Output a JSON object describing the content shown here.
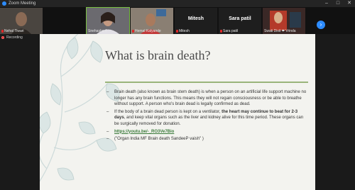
{
  "window": {
    "title": "Zoom Meeting"
  },
  "participants": [
    {
      "name": "Nehal Tiwari",
      "muted": true
    },
    {
      "name": "Snehasha J",
      "muted": false
    },
    {
      "name": "Hemal Kalyande",
      "muted": true
    },
    {
      "name": "Mitesh",
      "muted": true,
      "video": false
    },
    {
      "name": "Sara patil",
      "muted": true,
      "video": false
    },
    {
      "name": "Swati Dixit ❤ Vrinda",
      "muted": false
    }
  ],
  "recording": {
    "label": "Recording"
  },
  "slide": {
    "title": "What is brain death?",
    "b1": "Brain death (also known as brain stem death) is when a person on an artificial life support machine no longer has any brain functions. This means they will not regain consciousness or be able to breathe without support. A person who's brain dead is legally confirmed as dead.",
    "b2_pre": "If the body of a brain dead person is kept on a ventilator, ",
    "b2_bold": "the heart may continue to beat for 2-3 days",
    "b2_post": ", and keep vital organs such as the liver and kidney alive for this time period. These organs can be surgically removed for donation.",
    "link": "https://youtu.be/-_RO3Ve7Bio",
    "b4": "(\"Organ India MF Brain death SandeeP vaish\" )"
  },
  "colors": {
    "accent_rule": "#9ab57a",
    "link": "#3a7a3a",
    "zoom_blue": "#2d8cff"
  }
}
